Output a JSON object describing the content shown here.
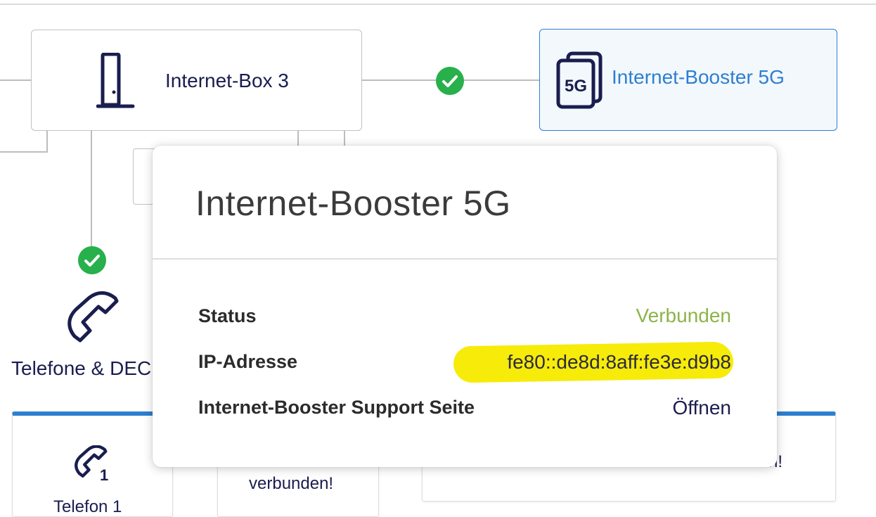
{
  "topology": {
    "router": {
      "label": "Internet-Box 3",
      "icon": "router-icon"
    },
    "booster": {
      "label": "Internet-Booster 5G",
      "icon": "5g-device-icon",
      "icon_text": "5G"
    },
    "phones": {
      "label": "Telefone & DEC",
      "icon": "phone-icon"
    },
    "status_icon": "check-circle-icon"
  },
  "cards": {
    "phone1": {
      "label": "Telefon 1",
      "badge": "1",
      "icon": "phone-icon"
    },
    "middle": {
      "text": "verbunden!"
    },
    "right": {
      "text": "n!"
    }
  },
  "popup": {
    "title": "Internet-Booster 5G",
    "rows": [
      {
        "label": "Status",
        "value": "Verbunden"
      },
      {
        "label": "IP-Adresse",
        "value": "fe80::de8d:8aff:fe3e:d9b8"
      },
      {
        "label": "Internet-Booster Support Seite",
        "value": "Öffnen"
      }
    ]
  },
  "colors": {
    "accent": "#2e7fd0",
    "connected": "#8cb44a",
    "check": "#27b04b",
    "navy": "#1a1d4e",
    "highlight": "#f7eb0a"
  }
}
